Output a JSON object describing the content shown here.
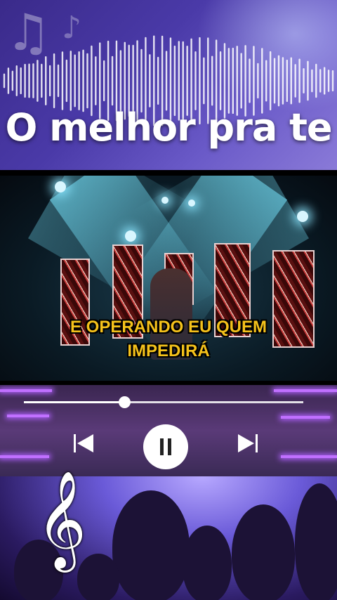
{
  "header": {
    "title": "O melhor pra te",
    "music_icon": "music-notes-icon"
  },
  "video": {
    "caption_line1": "E OPERANDO EU QUEM",
    "caption_line2": "IMPEDIRÁ",
    "caption_color": "#f5c21b"
  },
  "player": {
    "progress": 0.36,
    "prev_icon": "skip-previous-icon",
    "pause_icon": "pause-icon",
    "next_icon": "skip-next-icon"
  },
  "footer": {
    "icon": "treble-clef-icon"
  },
  "colors": {
    "header_bg": "#4a3aa8",
    "accent_neon": "#c070ff"
  }
}
